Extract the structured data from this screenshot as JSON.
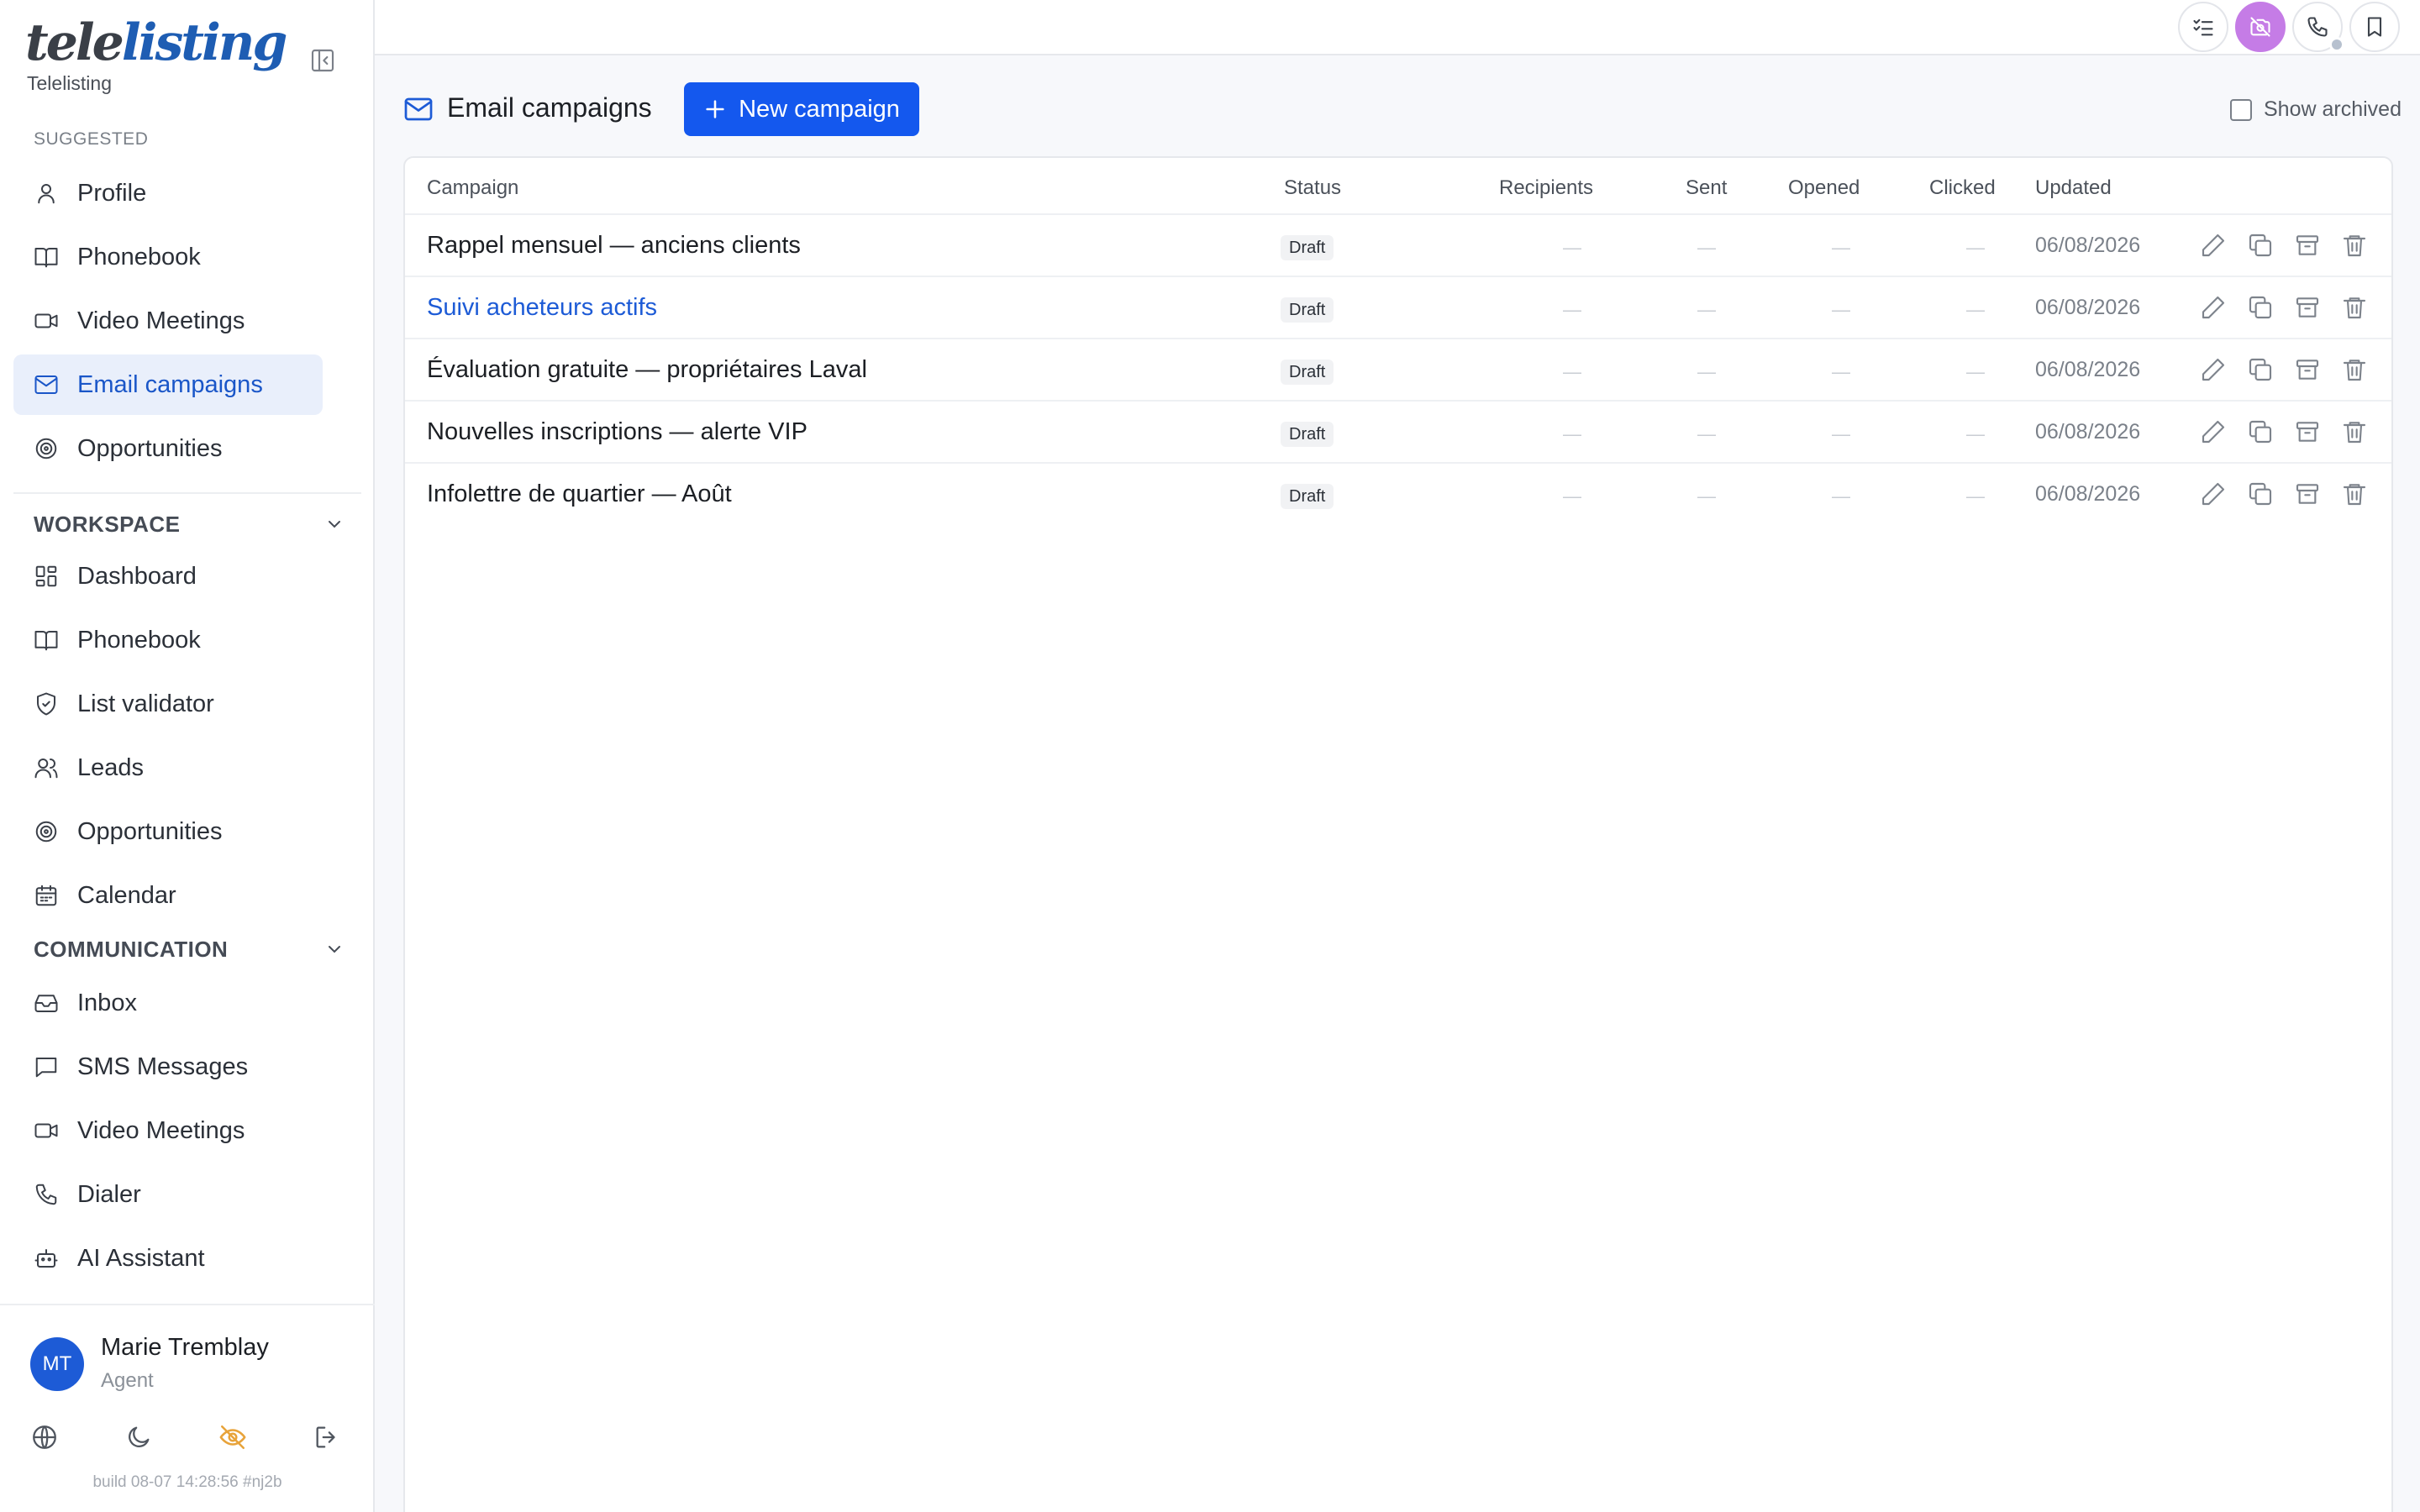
{
  "brand": {
    "logo_prefix": "tele",
    "logo_suffix": "listing",
    "name": "Telelisting"
  },
  "sidebar": {
    "suggested_label": "SUGGESTED",
    "suggested": [
      {
        "label": "Profile",
        "icon": "user-icon"
      },
      {
        "label": "Phonebook",
        "icon": "book-icon"
      },
      {
        "label": "Video Meetings",
        "icon": "video-icon"
      },
      {
        "label": "Email campaigns",
        "icon": "mail-icon",
        "active": true
      },
      {
        "label": "Opportunities",
        "icon": "target-icon"
      }
    ],
    "workspace_label": "WORKSPACE",
    "workspace": [
      {
        "label": "Dashboard",
        "icon": "dashboard-icon"
      },
      {
        "label": "Phonebook",
        "icon": "book-icon"
      },
      {
        "label": "List validator",
        "icon": "shield-check-icon"
      },
      {
        "label": "Leads",
        "icon": "users-icon"
      },
      {
        "label": "Opportunities",
        "icon": "target-icon"
      },
      {
        "label": "Calendar",
        "icon": "calendar-icon"
      }
    ],
    "communication_label": "COMMUNICATION",
    "communication": [
      {
        "label": "Inbox",
        "icon": "inbox-icon"
      },
      {
        "label": "SMS Messages",
        "icon": "message-icon"
      },
      {
        "label": "Video Meetings",
        "icon": "video-icon"
      },
      {
        "label": "Dialer",
        "icon": "phone-icon"
      },
      {
        "label": "AI Assistant",
        "icon": "bot-icon"
      }
    ]
  },
  "user": {
    "initials": "MT",
    "name": "Marie Tremblay",
    "role": "Agent"
  },
  "build": "build 08-07 14:28:56 #nj2b",
  "page": {
    "title": "Email campaigns",
    "new_button": "New campaign",
    "show_archived": "Show archived",
    "show_archived_checked": false
  },
  "table": {
    "headers": {
      "campaign": "Campaign",
      "status": "Status",
      "recipients": "Recipients",
      "sent": "Sent",
      "opened": "Opened",
      "clicked": "Clicked",
      "updated": "Updated"
    },
    "rows": [
      {
        "name": "Rappel mensuel — anciens clients",
        "status": "Draft",
        "recipients": "—",
        "sent": "—",
        "opened": "—",
        "clicked": "—",
        "updated": "06/08/2026"
      },
      {
        "name": "Suivi acheteurs actifs",
        "status": "Draft",
        "recipients": "—",
        "sent": "—",
        "opened": "—",
        "clicked": "—",
        "updated": "06/08/2026",
        "highlighted": true
      },
      {
        "name": "Évaluation gratuite — propriétaires Laval",
        "status": "Draft",
        "recipients": "—",
        "sent": "—",
        "opened": "—",
        "clicked": "—",
        "updated": "06/08/2026"
      },
      {
        "name": "Nouvelles inscriptions — alerte VIP",
        "status": "Draft",
        "recipients": "—",
        "sent": "—",
        "opened": "—",
        "clicked": "—",
        "updated": "06/08/2026"
      },
      {
        "name": "Infolettre de quartier — Août",
        "status": "Draft",
        "recipients": "—",
        "sent": "—",
        "opened": "—",
        "clicked": "—",
        "updated": "06/08/2026"
      }
    ]
  },
  "colors": {
    "accent": "#1458ee",
    "active_nav_bg": "#e9effb",
    "link": "#1d5bd6",
    "topbar_active": "#c57ce6",
    "privacy_icon": "#e8a33a"
  }
}
